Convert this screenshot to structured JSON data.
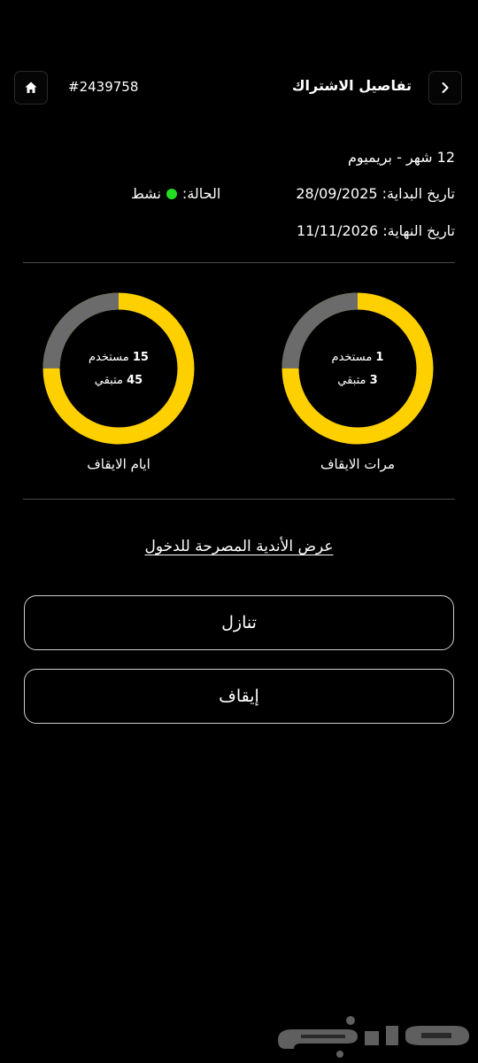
{
  "header": {
    "title": "تفاصيل الاشتراك",
    "subscription_id": "#2439758",
    "back_icon": "chevron-right-icon",
    "home_icon": "home-icon"
  },
  "plan": {
    "name": "12 شهر - بريميوم",
    "start_label": "تاريخ البداية:",
    "start_date": "28/09/2025",
    "end_label": "تاريخ النهاية:",
    "end_date": "11/11/2026",
    "status_label": "الحالة:",
    "status_value": "نشط",
    "status_color": "#22dd22"
  },
  "freezes_count": {
    "label": "مرات الايقاف",
    "used": 1,
    "used_label": "مستخدم",
    "remaining": 3,
    "remaining_label": "متبقي",
    "used_fraction": 0.25
  },
  "freeze_days": {
    "label": "ايام الايقاف",
    "used": 15,
    "used_label": "مستخدم",
    "remaining": 45,
    "remaining_label": "متبقي",
    "used_fraction": 0.25
  },
  "colors": {
    "remaining": "#ffd000",
    "used": "#6b6b6b",
    "background": "#000000"
  },
  "links": {
    "allowed_clubs": "عرض الأندية المصرحة للدخول"
  },
  "actions": {
    "transfer": "تنازل",
    "freeze": "إيقاف"
  },
  "watermark": {
    "text": "حراج"
  }
}
